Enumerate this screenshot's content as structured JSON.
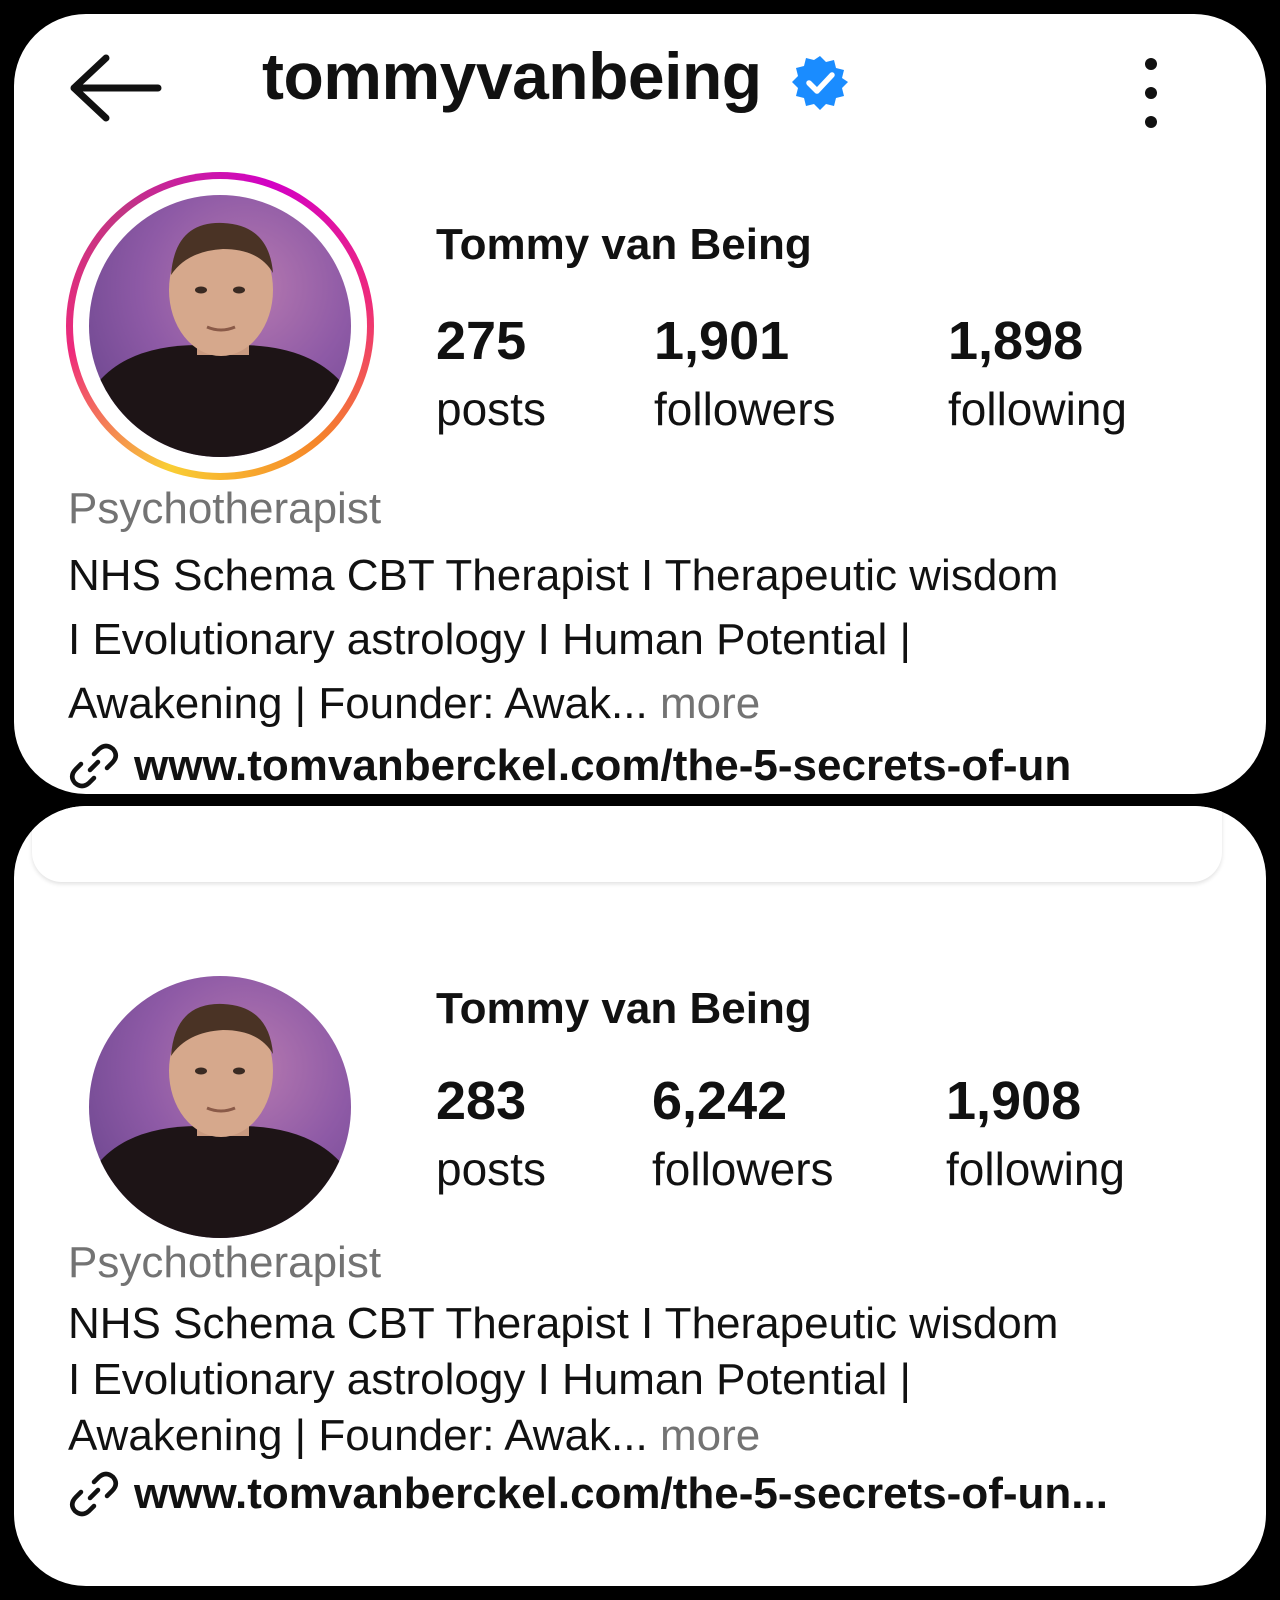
{
  "top": {
    "header": {
      "username": "tommyvanbeing"
    },
    "profile": {
      "display_name": "Tommy van Being",
      "stats": [
        {
          "value": "275",
          "label": "posts"
        },
        {
          "value": "1,901",
          "label": "followers"
        },
        {
          "value": "1,898",
          "label": "following"
        }
      ],
      "category": "Psychotherapist",
      "bio_lines": [
        "NHS Schema CBT Therapist I Therapeutic wisdom",
        "I Evolutionary astrology I Human Potential |",
        "Awakening |  Founder:  Awak..."
      ],
      "more": "more",
      "link": "www.tomvanberckel.com/the-5-secrets-of-un"
    }
  },
  "bottom": {
    "profile": {
      "display_name": "Tommy van Being",
      "stats": [
        {
          "value": "283",
          "label": "posts"
        },
        {
          "value": "6,242",
          "label": "followers"
        },
        {
          "value": "1,908",
          "label": "following"
        }
      ],
      "category": "Psychotherapist",
      "bio_lines": [
        "NHS Schema CBT Therapist I Therapeutic wisdom",
        "I Evolutionary astrology I Human Potential |",
        "Awakening |  Founder:  Awak..."
      ],
      "more": "more",
      "link": "www.tomvanberckel.com/the-5-secrets-of-un..."
    }
  },
  "icons": {
    "back": "arrow-left-icon",
    "verified": "verified-badge-icon",
    "more": "more-vertical-icon",
    "link": "link-icon"
  },
  "colors": {
    "verified": "#1a8cff",
    "secondary_text": "#737373",
    "story_ring": [
      "#f9ce34",
      "#ee2a7b",
      "#d300c5"
    ]
  }
}
